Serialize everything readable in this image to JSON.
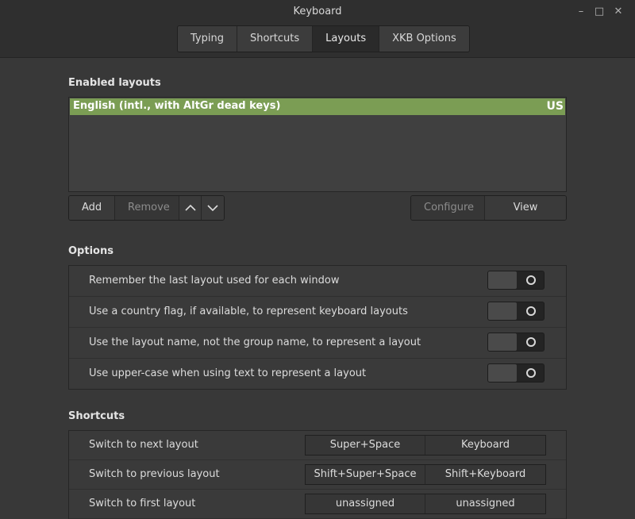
{
  "window": {
    "title": "Keyboard",
    "controls": {
      "minimize": "–",
      "maximize": "□",
      "close": "✕"
    }
  },
  "tabs": [
    {
      "label": "Typing",
      "active": false
    },
    {
      "label": "Shortcuts",
      "active": false
    },
    {
      "label": "Layouts",
      "active": true
    },
    {
      "label": "XKB Options",
      "active": false
    }
  ],
  "enabled_layouts": {
    "heading": "Enabled layouts",
    "items": [
      {
        "name": "English (intl., with AltGr dead keys)",
        "code": "US",
        "selected": true
      }
    ],
    "buttons": {
      "add": "Add",
      "remove": "Remove",
      "move_up_icon": "chevron-up-icon",
      "move_down_icon": "chevron-down-icon",
      "configure": "Configure",
      "view_layout": "View layout"
    }
  },
  "options": {
    "heading": "Options",
    "items": [
      {
        "label": "Remember the last layout used for each window",
        "enabled": false
      },
      {
        "label": "Use a country flag, if available, to represent keyboard layouts",
        "enabled": false
      },
      {
        "label": "Use the layout name, not the group name, to represent a layout",
        "enabled": false
      },
      {
        "label": "Use upper-case when using text to represent a layout",
        "enabled": false
      }
    ]
  },
  "shortcuts": {
    "heading": "Shortcuts",
    "items": [
      {
        "label": "Switch to next layout",
        "primary": "Super+Space",
        "secondary": "Keyboard"
      },
      {
        "label": "Switch to previous layout",
        "primary": "Shift+Super+Space",
        "secondary": "Shift+Keyboard"
      },
      {
        "label": "Switch to first layout",
        "primary": "unassigned",
        "secondary": "unassigned"
      }
    ]
  },
  "colors": {
    "accent": "#7b9d54",
    "background": "#383838",
    "titlebar": "#2f2f2f"
  }
}
